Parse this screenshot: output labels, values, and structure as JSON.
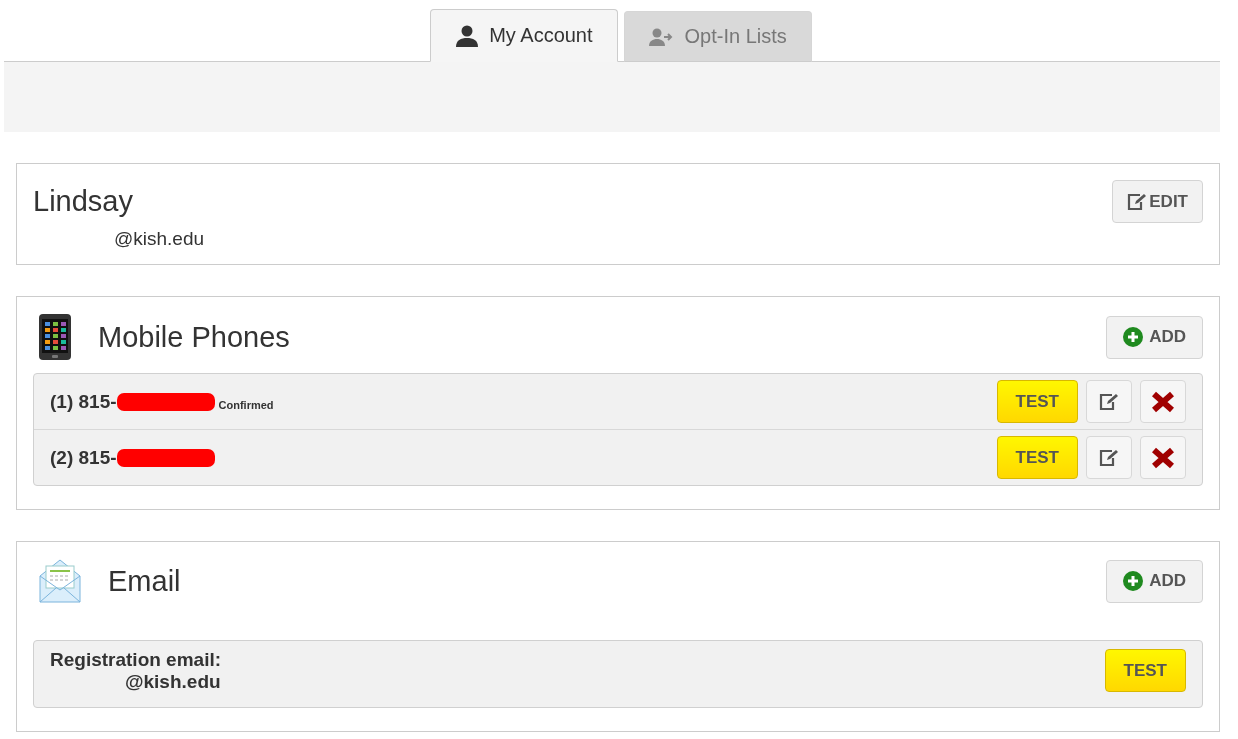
{
  "tabs": [
    {
      "label": "My Account",
      "kind": "account",
      "selected": true
    },
    {
      "label": "Opt-In Lists",
      "kind": "lists",
      "selected": false
    }
  ],
  "account": {
    "first_name": "Lindsay",
    "email": "@kish.edu",
    "edit_button": "EDIT"
  },
  "mobile_phones": {
    "title": "Mobile Phones",
    "add_button": "ADD",
    "rows": [
      {
        "number": "(1) 815-",
        "status": "Confirmed",
        "test_button": "TEST"
      },
      {
        "number": "(2) 815-",
        "test_button": "TEST"
      }
    ]
  },
  "email": {
    "title": "Email",
    "add_button": "ADD",
    "rows": [
      {
        "label": "Registration email:",
        "address": "@kish.edu",
        "test_button": "TEST"
      }
    ]
  }
}
